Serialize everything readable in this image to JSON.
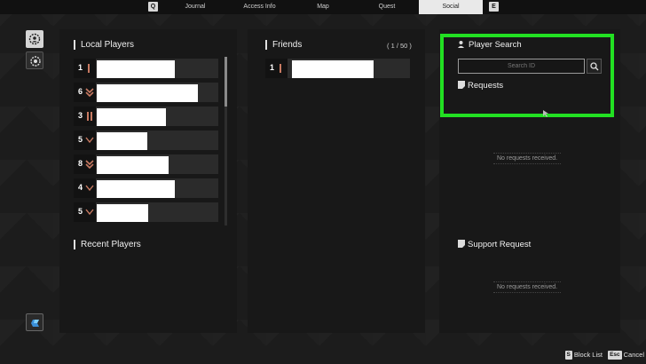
{
  "nav": {
    "prev_key": "Q",
    "next_key": "E",
    "tabs": [
      "Journal",
      "Access Info",
      "Map",
      "Quest",
      "Social"
    ],
    "active_tab": "Social"
  },
  "local_players": {
    "title": "Local Players",
    "rows": [
      {
        "rank": "1",
        "rank_icon": "single-bar"
      },
      {
        "rank": "6",
        "rank_icon": "double-chevron"
      },
      {
        "rank": "3",
        "rank_icon": "double-bar"
      },
      {
        "rank": "5",
        "rank_icon": "wing"
      },
      {
        "rank": "8",
        "rank_icon": "double-chevron"
      },
      {
        "rank": "4",
        "rank_icon": "wing"
      },
      {
        "rank": "5",
        "rank_icon": "wing"
      }
    ]
  },
  "recent_players": {
    "title": "Recent Players"
  },
  "friends": {
    "title": "Friends",
    "count": "( 1 / 50 )",
    "rows": [
      {
        "rank": "1",
        "rank_icon": "single-bar"
      }
    ]
  },
  "player_search": {
    "title": "Player Search",
    "placeholder": "Search ID"
  },
  "requests": {
    "title": "Requests",
    "empty_text": "No requests received."
  },
  "support_request": {
    "title": "Support Request",
    "empty_text": "No requests received."
  },
  "actions": [
    {
      "key": "S",
      "label": "Block List"
    },
    {
      "key": "Esc",
      "label": "Cancel"
    }
  ],
  "colors": {
    "highlight": "#22e022",
    "rank_accent": "#c87a62",
    "active_tab_bg": "#e9e9e9"
  }
}
